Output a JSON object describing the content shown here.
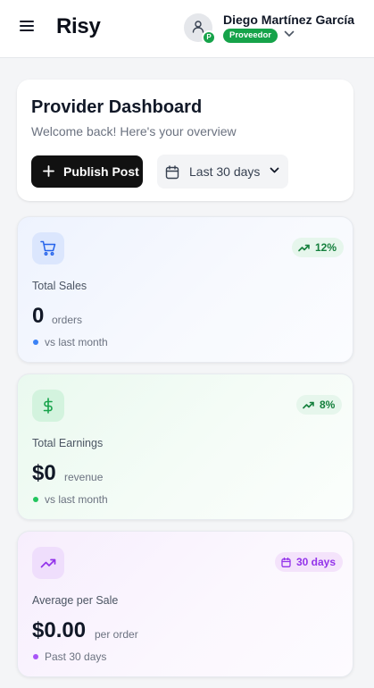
{
  "header": {
    "brand": "Risy",
    "menu_icon": "menu-icon",
    "user": {
      "name": "Diego Martínez García",
      "role": "Proveedor",
      "avatar_badge": "P",
      "avatar_icon": "user-icon"
    }
  },
  "welcome": {
    "title": "Provider Dashboard",
    "subtitle": "Welcome back! Here's your overview",
    "publish_label": "Publish Post",
    "range_value": "Last 30 days"
  },
  "stats": {
    "sales": {
      "icon": "cart-icon",
      "trend": "12%",
      "label": "Total Sales",
      "value": "0",
      "unit": "orders",
      "footnote": "vs last month",
      "accent": "#2563eb"
    },
    "earnings": {
      "icon": "dollar-icon",
      "trend": "8%",
      "label": "Total Earnings",
      "value": "$0",
      "unit": "revenue",
      "footnote": "vs last month",
      "accent": "#16a34a"
    },
    "average": {
      "icon": "trending-up-icon",
      "trend": "30 days",
      "label": "Average per Sale",
      "value": "$0.00",
      "unit": "per order",
      "footnote": "Past 30 days",
      "accent": "#9333ea"
    }
  },
  "colors": {
    "primary_button": "#111111",
    "success": "#16a34a",
    "text": "#111827",
    "muted": "#6b7280"
  }
}
